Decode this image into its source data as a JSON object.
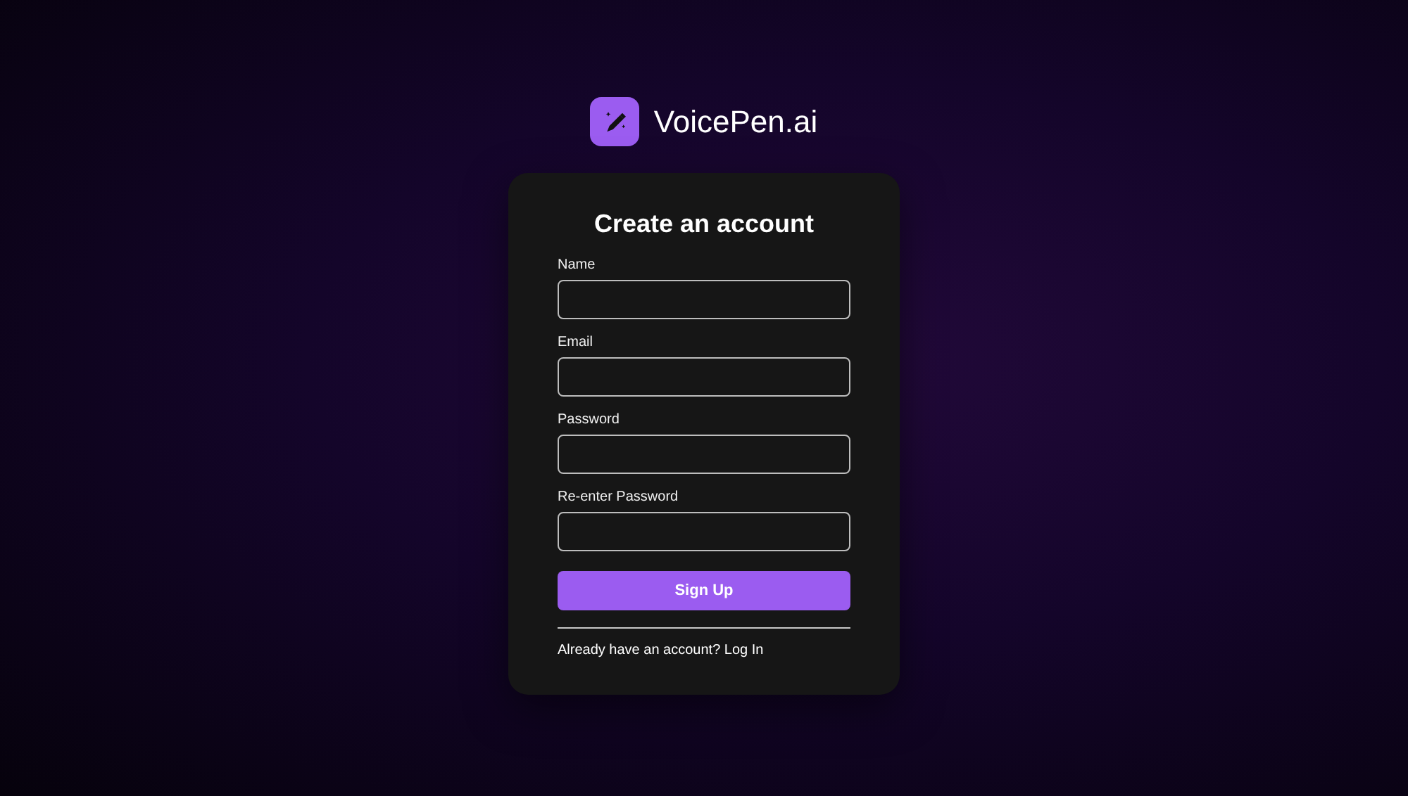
{
  "brand": {
    "name": "VoicePen.ai"
  },
  "form": {
    "title": "Create an account",
    "fields": [
      {
        "label": "Name"
      },
      {
        "label": "Email"
      },
      {
        "label": "Password"
      },
      {
        "label": "Re-enter Password"
      }
    ],
    "submit": "Sign Up",
    "footer": {
      "text": "Already have an account?",
      "link": "Log In"
    }
  }
}
